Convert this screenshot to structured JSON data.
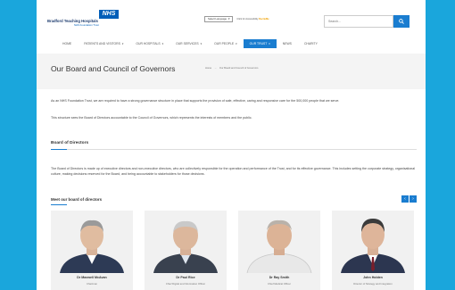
{
  "header": {
    "nhs_badge": "NHS",
    "trust_name": "Bradford Teaching Hospitals",
    "trust_sub": "NHS Foundation Trust",
    "language_select": "Select Language",
    "accessibility_prefix": "Click for Accessibility",
    "accessibility_brand": "ReciteMe",
    "search_placeholder": "Search..."
  },
  "nav": [
    {
      "label": "Home"
    },
    {
      "label": "Patients and Visitors"
    },
    {
      "label": "Our Hospitals"
    },
    {
      "label": "Our Services"
    },
    {
      "label": "Our People"
    },
    {
      "label": "Our Trust",
      "active": true
    },
    {
      "label": "News"
    },
    {
      "label": "Charity"
    }
  ],
  "page": {
    "title": "Our Board and Council of Governors",
    "breadcrumb_home": "Home",
    "breadcrumb_current": "Our Board and Council of Governors"
  },
  "content": {
    "intro": "As an NHS Foundation Trust, we are required to have a strong governance structure in place that supports the provision of safe, effective, caring and responsive care for the 500,000 people that we serve.",
    "structure": "This structure sees the Board of Directors accountable to the Council of Governors, which represents the interests of members and the public.",
    "board_heading": "Board of Directors",
    "board_text": "The Board of Directors is made up of executive directors and non-executive directors, who are collectively responsible for the operation and performance of the Trust, and for its effective governance. This includes setting the corporate strategy, organisational culture, making decisions reserved for the Board, and being accountable to stakeholders for those decisions.",
    "meet_heading": "Meet our board of directors"
  },
  "directors": [
    {
      "name": "Dr Maxwell McAvan",
      "role": "Chairman",
      "shirt": "#2d3a55"
    },
    {
      "name": "Dr Paul Rice",
      "role": "Chief Digital and Information Officer",
      "shirt": "#39414f"
    },
    {
      "name": "Dr Ray Smith",
      "role": "Chief Medical Officer",
      "shirt": "#e8e8e8"
    },
    {
      "name": "John Holden",
      "role": "Director of Strategy and Integration",
      "shirt": "#2c3650"
    }
  ],
  "colors": {
    "frame": "#1aa6dc",
    "accent": "#1a7dd0",
    "nhs_blue": "#005eb8"
  }
}
